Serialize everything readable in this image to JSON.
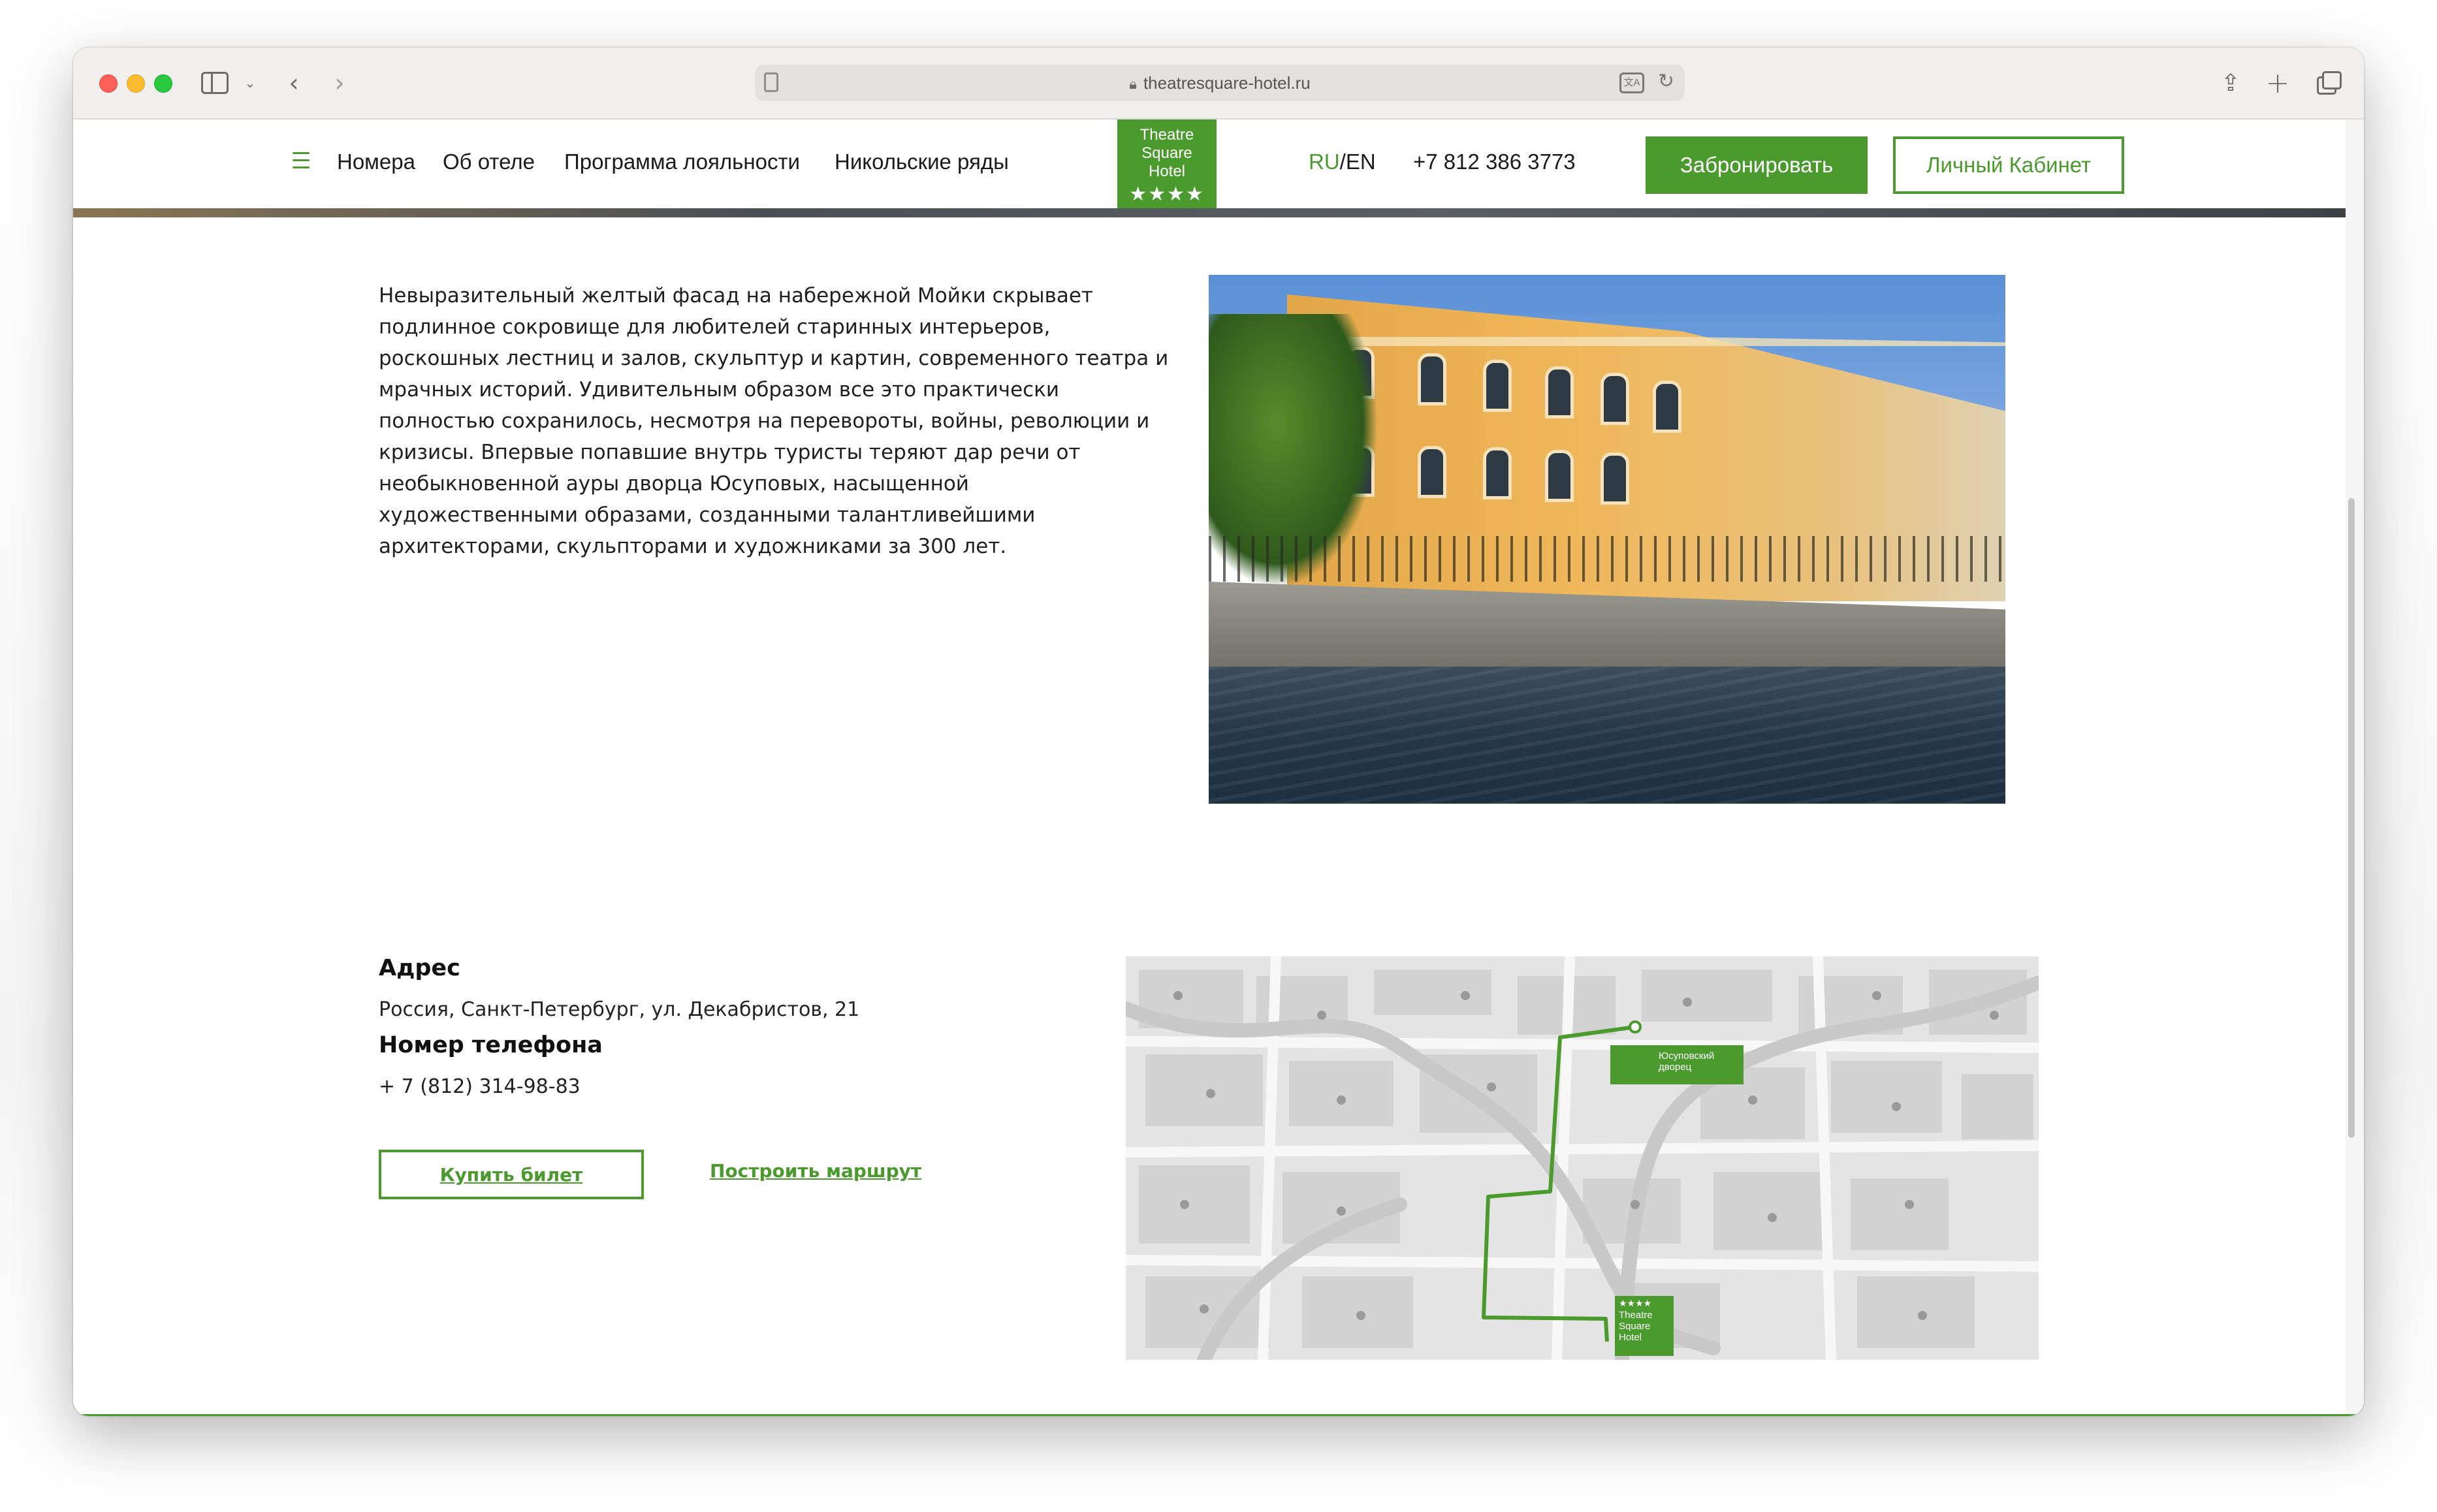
{
  "browser": {
    "url": "theatresquare-hotel.ru"
  },
  "header": {
    "nav": [
      "Номера",
      "Об отеле",
      "Программа лояльности",
      "Никольские ряды"
    ],
    "logo_lines": [
      "Theatre",
      "Square",
      "Hotel"
    ],
    "logo_stars": "★★★★",
    "lang_ru": "RU",
    "lang_sep": "/EN",
    "phone": "+7 812 386 3773",
    "book_label": "Забронировать",
    "cabinet_label": "Личный Кабинет"
  },
  "content": {
    "description": "Невыразительный желтый фасад на набережной Мойки скрывает подлинное сокровище для любителей старинных интерьеров, роскошных лестниц и залов, скульптур и картин, современного театра и мрачных историй. Удивительным образом все это практически полностью сохранилось, несмотря на перевороты, войны, революции и кризисы. Впервые попавшие внутрь туристы теряют дар речи от необыкновенной ауры дворца Юсуповых, насыщенной художественными образами, созданными талантливейшими архитекторами, скульпторами и художниками за 300 лет."
  },
  "contact": {
    "address_heading": "Адрес",
    "address": "Россия, Санкт-Петербург, ул. Декабристов, 21",
    "phone_heading": "Номер телефона",
    "phone": "+ 7 (812) 314-98-83",
    "ticket_label": "Купить билет",
    "route_label": "Построить маршрут"
  },
  "map": {
    "palace_label": "Юсуповский дворец",
    "hotel_stars": "★★★★",
    "hotel_label": "Theatre Square Hotel"
  },
  "colors": {
    "brand_green": "#4a9a2e"
  }
}
